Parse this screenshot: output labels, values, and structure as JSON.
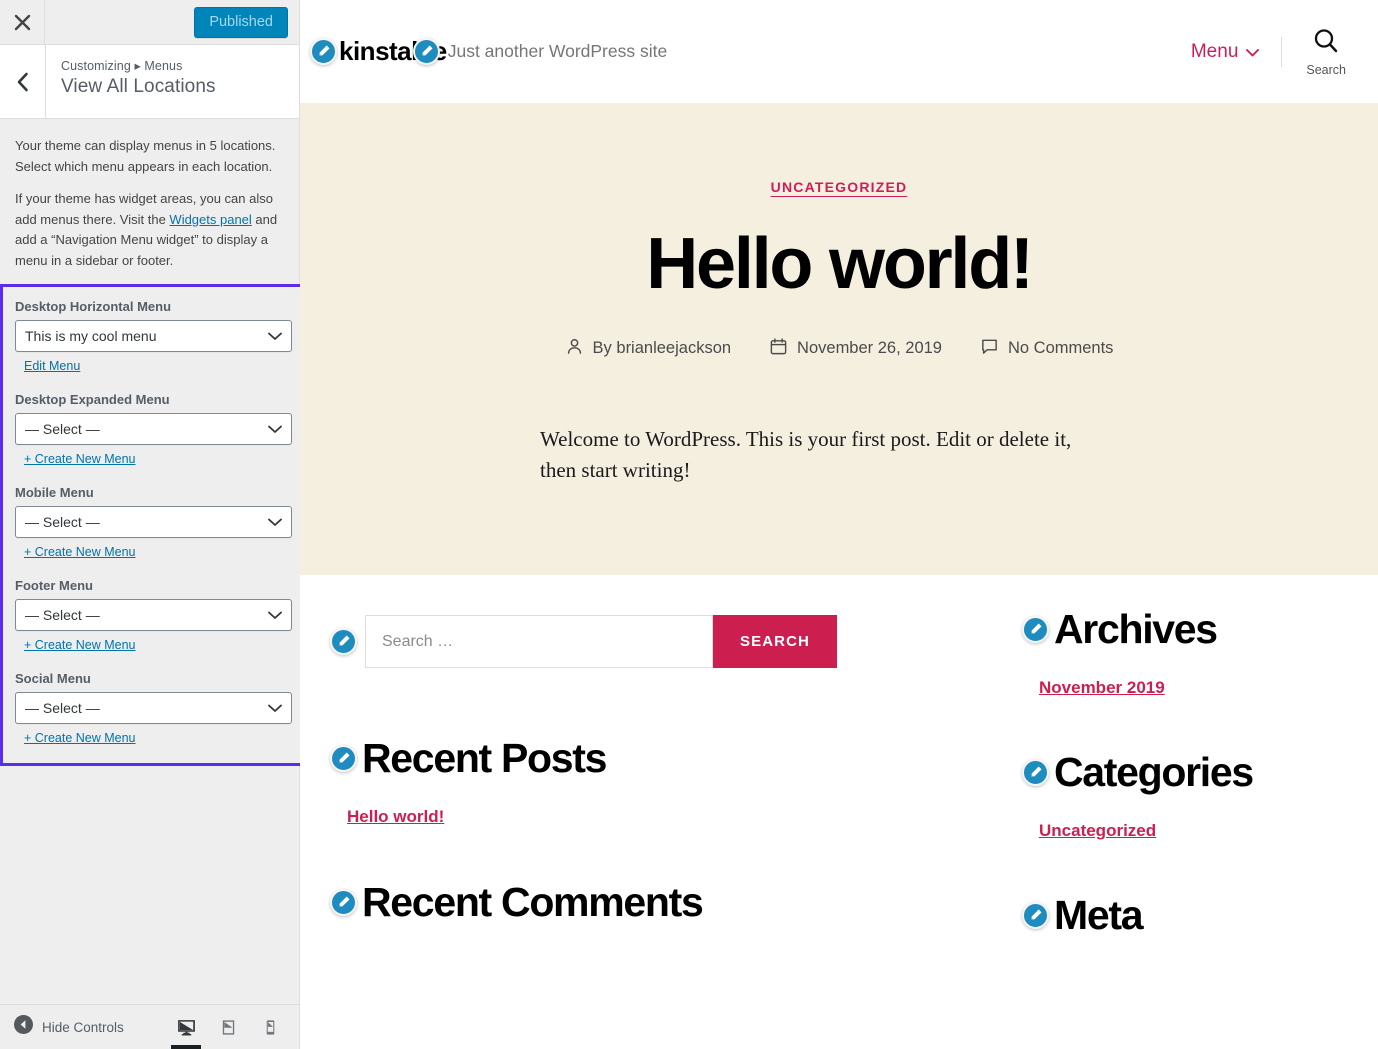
{
  "customizer": {
    "close_label": "Close",
    "publish_label": "Published",
    "back_label": "Back",
    "breadcrumb": "Customizing ▸ Menus",
    "panel_title": "View All Locations",
    "description_1": "Your theme can display menus in 5 locations. Select which menu appears in each location.",
    "description_2_pre": "If your theme has widget areas, you can also add menus there. Visit the ",
    "description_2_link": "Widgets panel",
    "description_2_post": " and add a “Navigation Menu widget” to display a menu in a sidebar or footer.",
    "highlight_color": "#5a2ded",
    "locations": [
      {
        "label": "Desktop Horizontal Menu",
        "value": "This is my cool menu",
        "link": "Edit Menu"
      },
      {
        "label": "Desktop Expanded Menu",
        "value": "— Select —",
        "link": "+ Create New Menu"
      },
      {
        "label": "Mobile Menu",
        "value": "— Select —",
        "link": "+ Create New Menu"
      },
      {
        "label": "Footer Menu",
        "value": "— Select —",
        "link": "+ Create New Menu"
      },
      {
        "label": "Social Menu",
        "value": "— Select —",
        "link": "+ Create New Menu"
      }
    ],
    "footer": {
      "hide_controls": "Hide Controls",
      "devices": [
        {
          "name": "desktop",
          "active": true
        },
        {
          "name": "tablet",
          "active": false
        },
        {
          "name": "mobile",
          "active": false
        }
      ]
    }
  },
  "preview": {
    "header": {
      "site_title": "kinstalife",
      "tagline": "Just another WordPress site",
      "menu_label": "Menu",
      "search_label": "Search",
      "accent_color": "#cc1f5a"
    },
    "hero": {
      "background_color": "#f5efe0",
      "category": "UNCATEGORIZED",
      "title": "Hello world!",
      "author": "By brianleejackson",
      "date": "November 26, 2019",
      "comments": "No Comments",
      "body": "Welcome to WordPress. This is your first post. Edit or delete it, then start writing!"
    },
    "widgets": {
      "search": {
        "placeholder": "Search …",
        "button_label": "SEARCH"
      },
      "left": [
        {
          "title": "Recent Posts",
          "items": [
            "Hello world!"
          ]
        },
        {
          "title": "Recent Comments",
          "items": []
        }
      ],
      "right": [
        {
          "title": "Archives",
          "items": [
            "November 2019"
          ]
        },
        {
          "title": "Categories",
          "items": [
            "Uncategorized"
          ]
        },
        {
          "title": "Meta",
          "items": []
        }
      ]
    }
  }
}
